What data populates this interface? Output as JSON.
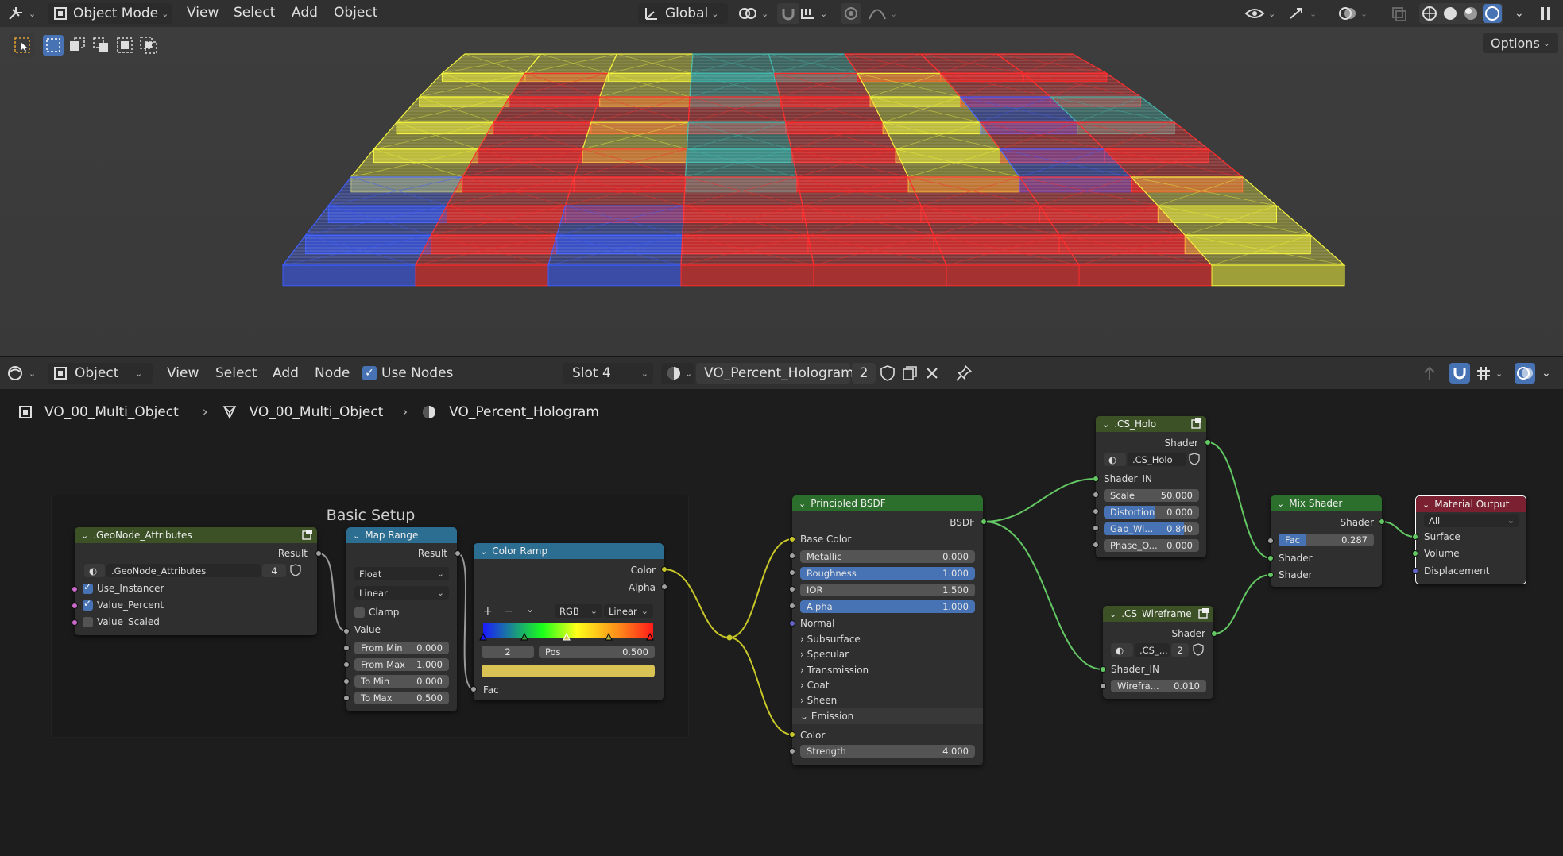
{
  "top_header": {
    "mode": "Object Mode",
    "menus": [
      "View",
      "Select",
      "Add",
      "Object"
    ],
    "orientation": "Global",
    "options": "Options"
  },
  "node_header": {
    "editor_type": "Object",
    "menus": [
      "View",
      "Select",
      "Add",
      "Node"
    ],
    "use_nodes": "Use Nodes",
    "slot": "Slot 4",
    "material": "VO_Percent_Hologram",
    "users": "2"
  },
  "breadcrumb": [
    "VO_00_Multi_Object",
    "VO_00_Multi_Object",
    "VO_Percent_Hologram"
  ],
  "frame": {
    "title": "Basic Setup"
  },
  "nodes": {
    "geo": {
      "title": ".GeoNode_Attributes",
      "result": "Result",
      "datablock": ".GeoNode_Attributes",
      "users": "4",
      "items": [
        "Use_Instancer",
        "Value_Percent",
        "Value_Scaled"
      ]
    },
    "maprange": {
      "title": "Map Range",
      "result": "Result",
      "type": "Float",
      "interp": "Linear",
      "clamp": "Clamp",
      "value": "Value",
      "fields": [
        {
          "label": "From Min",
          "value": "0.000"
        },
        {
          "label": "From Max",
          "value": "1.000"
        },
        {
          "label": "To Min",
          "value": "0.000"
        },
        {
          "label": "To Max",
          "value": "0.500"
        }
      ]
    },
    "colorramp": {
      "title": "Color Ramp",
      "color": "Color",
      "alpha": "Alpha",
      "mode": "RGB",
      "interp": "Linear",
      "index": "2",
      "pos_label": "Pos",
      "pos_value": "0.500",
      "fac": "Fac"
    },
    "bsdf": {
      "title": "Principled BSDF",
      "output": "BSDF",
      "base_color": "Base Color",
      "fields": [
        {
          "label": "Metallic",
          "value": "0.000"
        },
        {
          "label": "Roughness",
          "value": "1.000"
        },
        {
          "label": "IOR",
          "value": "1.500"
        },
        {
          "label": "Alpha",
          "value": "1.000"
        }
      ],
      "normal": "Normal",
      "panels": [
        "Subsurface",
        "Specular",
        "Transmission",
        "Coat",
        "Sheen",
        "Emission"
      ],
      "color": "Color",
      "strength_label": "Strength",
      "strength_value": "4.000"
    },
    "holo": {
      "title": ".CS_Holo",
      "shader": "Shader",
      "datablock": ".CS_Holo",
      "shader_in": "Shader_IN",
      "fields": [
        {
          "label": "Scale",
          "value": "50.000"
        },
        {
          "label": "Distortion",
          "value": "0.000"
        },
        {
          "label": "Gap_Wi...",
          "value": "0.840"
        },
        {
          "label": "Phase_O...",
          "value": "0.000"
        }
      ]
    },
    "wire": {
      "title": ".CS_Wireframe",
      "shader": "Shader",
      "datablock": ".CS_...",
      "users": "2",
      "shader_in": "Shader_IN",
      "field_label": "Wirefra...",
      "field_value": "0.010"
    },
    "mix": {
      "title": "Mix Shader",
      "shader": "Shader",
      "fac_label": "Fac",
      "fac_value": "0.287",
      "in1": "Shader",
      "in2": "Shader"
    },
    "output": {
      "title": "Material Output",
      "target": "All",
      "surface": "Surface",
      "volume": "Volume",
      "displacement": "Displacement"
    }
  },
  "colors": {
    "holo_red": "#ff2a2a",
    "holo_yellow": "#f2f23a",
    "holo_blue": "#3b5bff",
    "holo_teal": "#3fb4a8",
    "ramp_swatch": "#d9c355"
  }
}
